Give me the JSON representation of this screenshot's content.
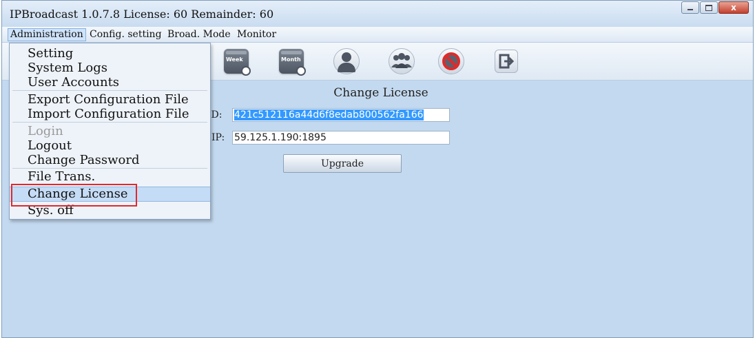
{
  "window": {
    "title": "IPBroadcast 1.0.7.8 License: 60 Remainder: 60",
    "controls": {
      "minimize": "",
      "maximize": "",
      "close": "x"
    }
  },
  "menubar": {
    "items": [
      "Administration",
      "Config. setting",
      "Broad. Mode",
      "Monitor"
    ]
  },
  "toolbar": {
    "icons": [
      {
        "name": "week-schedule-icon",
        "label": "Week"
      },
      {
        "name": "month-schedule-icon",
        "label": "Month"
      },
      {
        "name": "user-icon",
        "label": ""
      },
      {
        "name": "group-icon",
        "label": ""
      },
      {
        "name": "mute-icon",
        "label": ""
      },
      {
        "name": "exit-icon",
        "label": ""
      }
    ]
  },
  "dropdown": {
    "items": [
      {
        "label": "Setting",
        "state": "normal"
      },
      {
        "label": "System Logs",
        "state": "normal"
      },
      {
        "label": "User Accounts",
        "state": "normal"
      },
      {
        "label": "Export Configuration File",
        "state": "normal"
      },
      {
        "label": "Import Configuration File",
        "state": "normal"
      },
      {
        "label": "Login",
        "state": "disabled"
      },
      {
        "label": "Logout",
        "state": "normal"
      },
      {
        "label": "Change Password",
        "state": "normal"
      },
      {
        "label": "File Trans.",
        "state": "normal"
      },
      {
        "label": "Change License",
        "state": "highlighted"
      },
      {
        "label": "Sys. off",
        "state": "normal"
      }
    ]
  },
  "panel": {
    "title": "Change License",
    "id_label": "ID:",
    "id_value": "421c512116a44d6f8edab800562fa166",
    "ip_label": "IP:",
    "ip_value": "59.125.1.190:1895",
    "upgrade_label": "Upgrade"
  },
  "colors": {
    "client_bg": "#c3d9ef",
    "selection": "#3399ff",
    "highlight_box": "#e0282d"
  }
}
